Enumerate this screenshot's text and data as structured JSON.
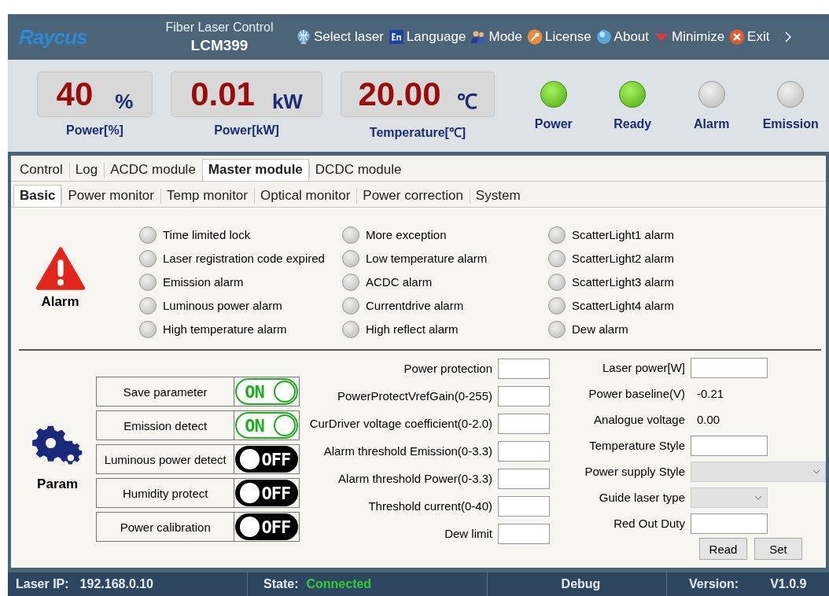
{
  "header": {
    "logo": "Raycus",
    "subtitle": "Fiber Laser Control",
    "model": "LCM399",
    "menu": [
      {
        "label": "Select laser"
      },
      {
        "label": "Language"
      },
      {
        "label": "Mode"
      },
      {
        "label": "License"
      },
      {
        "label": "About"
      },
      {
        "label": "Minimize"
      },
      {
        "label": "Exit"
      }
    ]
  },
  "readouts": [
    {
      "value": "40",
      "unit": "%",
      "label": "Power[%]"
    },
    {
      "value": "0.01",
      "unit": "kW",
      "label": "Power[kW]"
    },
    {
      "value": "20.00",
      "unit": "℃",
      "label": "Temperature[℃]"
    }
  ],
  "lamps": [
    {
      "label": "Power",
      "on": true
    },
    {
      "label": "Ready",
      "on": true
    },
    {
      "label": "Alarm",
      "on": false
    },
    {
      "label": "Emission",
      "on": false
    }
  ],
  "tabs": [
    {
      "label": "Control",
      "selected": false
    },
    {
      "label": "Log",
      "selected": false
    },
    {
      "label": "ACDC module",
      "selected": false
    },
    {
      "label": "Master module",
      "selected": true
    },
    {
      "label": "DCDC module",
      "selected": false
    }
  ],
  "subtabs": [
    {
      "label": "Basic",
      "selected": true
    },
    {
      "label": "Power monitor",
      "selected": false
    },
    {
      "label": "Temp monitor",
      "selected": false
    },
    {
      "label": "Optical monitor",
      "selected": false
    },
    {
      "label": "Power correction",
      "selected": false
    },
    {
      "label": "System",
      "selected": false
    }
  ],
  "alarm": {
    "title": "Alarm",
    "columns": [
      [
        {
          "label": "Time limited lock",
          "on": false
        },
        {
          "label": "Laser registration code expired",
          "on": false
        },
        {
          "label": "Emission alarm",
          "on": false
        },
        {
          "label": "Luminous power alarm",
          "on": false
        },
        {
          "label": "High temperature alarm",
          "on": false
        }
      ],
      [
        {
          "label": "More exception",
          "on": false
        },
        {
          "label": "Low temperature alarm",
          "on": false
        },
        {
          "label": "ACDC alarm",
          "on": false
        },
        {
          "label": "Currentdrive alarm",
          "on": false
        },
        {
          "label": "High reflect alarm",
          "on": false
        }
      ],
      [
        {
          "label": "ScatterLight1 alarm",
          "on": false
        },
        {
          "label": "ScatterLight2 alarm",
          "on": false
        },
        {
          "label": "ScatterLight3 alarm",
          "on": false
        },
        {
          "label": "ScatterLight4 alarm",
          "on": false
        },
        {
          "label": "Dew alarm",
          "on": false
        }
      ]
    ]
  },
  "param": {
    "title": "Param",
    "switches": [
      {
        "label": "Save parameter",
        "on": true,
        "text": "ON"
      },
      {
        "label": "Emission detect",
        "on": true,
        "text": "ON"
      },
      {
        "label": "Luminous power detect",
        "on": false,
        "text": "OFF"
      },
      {
        "label": "Humidity protect",
        "on": false,
        "text": "OFF"
      },
      {
        "label": "Power calibration",
        "on": false,
        "text": "OFF"
      }
    ],
    "fields": [
      {
        "label": "Power protection",
        "kind": "input"
      },
      {
        "label": "PowerProtectVrefGain(0-255)",
        "kind": "input"
      },
      {
        "label": "CurDriver voltage coefficient(0-2.0)",
        "kind": "input"
      },
      {
        "label": "Alarm threshold Emission(0-3.3)",
        "kind": "input"
      },
      {
        "label": "Alarm threshold Power(0-3.3)",
        "kind": "input"
      },
      {
        "label": "Threshold current(0-40)",
        "kind": "input"
      },
      {
        "label": "Dew limit",
        "kind": "input"
      }
    ],
    "settings": [
      {
        "label": "Laser power[W]",
        "kind": "input"
      },
      {
        "label": "Power baseline(V)",
        "kind": "reading",
        "value": "-0.21"
      },
      {
        "label": "Analogue voltage",
        "kind": "reading",
        "value": "0.00"
      },
      {
        "label": "Temperature Style",
        "kind": "input"
      },
      {
        "label": "Power supply Style",
        "kind": "wide-select"
      },
      {
        "label": "Guide laser type",
        "kind": "select"
      },
      {
        "label": "Red Out Duty",
        "kind": "input"
      }
    ],
    "buttons": [
      "Read",
      "Set"
    ]
  },
  "status_bar": [
    {
      "label": "Laser IP:",
      "value": "192.168.0.10"
    },
    {
      "label": "State:",
      "value": "Connected",
      "color": "#33cc33"
    },
    {
      "label": "Debug"
    },
    {
      "label": "Version:",
      "value": "V1.0.9"
    }
  ]
}
